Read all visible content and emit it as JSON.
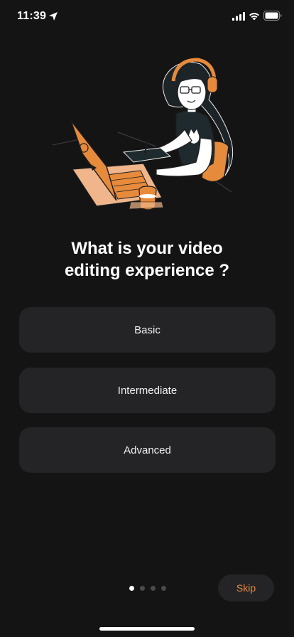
{
  "status_bar": {
    "time": "11:39"
  },
  "onboarding": {
    "question_line1": "What is your video",
    "question_line2": "editing experience ?",
    "options": [
      {
        "label": "Basic"
      },
      {
        "label": "Intermediate"
      },
      {
        "label": "Advanced"
      }
    ],
    "pagination": {
      "total": 4,
      "active_index": 0
    },
    "skip_label": "Skip"
  },
  "colors": {
    "background": "#141415",
    "card": "#242426",
    "accent": "#e68a3c",
    "text": "#ffffff"
  }
}
